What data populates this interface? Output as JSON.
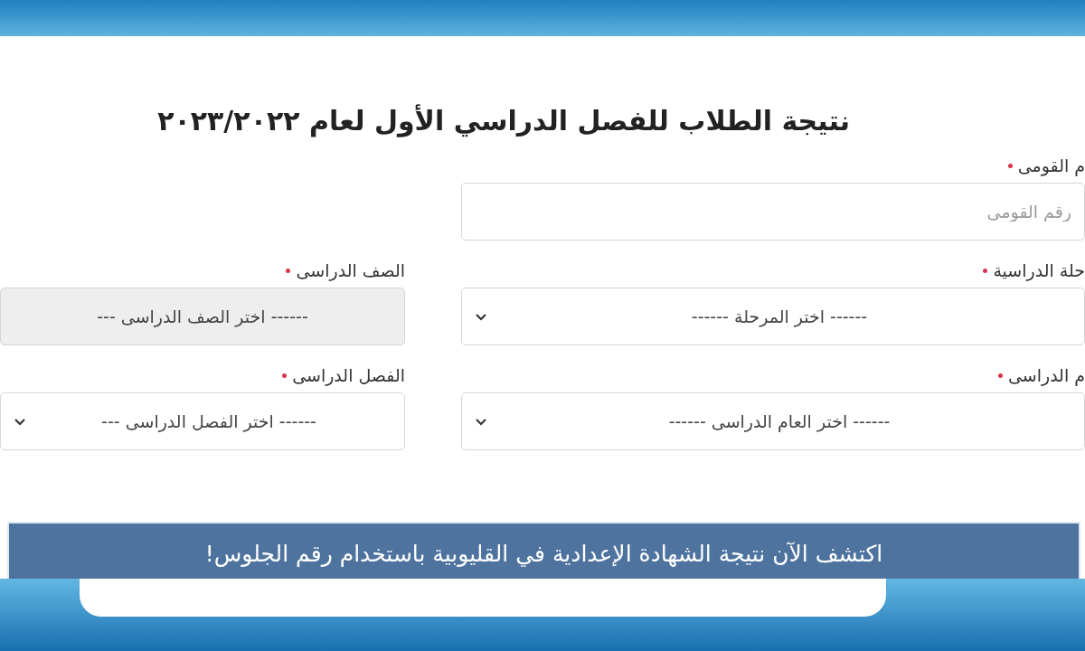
{
  "title": "نتيجة الطلاب للفصل الدراسي الأول لعام ٢٠٢٣/٢٠٢٢",
  "fields": [
    {
      "kind": "text",
      "label": "م القومى",
      "required": true,
      "placeholder": "رقم القومى",
      "disabled": false
    },
    {
      "kind": "spacer"
    },
    {
      "kind": "select",
      "label": "حلة الدراسية",
      "required": true,
      "value": "------ اختر المرحلة ------",
      "disabled": false
    },
    {
      "kind": "select",
      "label": "الصف الدراسى",
      "required": true,
      "value": "------ اختر الصف الدراسى ---",
      "disabled": true
    },
    {
      "kind": "select",
      "label": "م الدراسى",
      "required": true,
      "value": "------ اختر العام الدراسى ------",
      "disabled": false
    },
    {
      "kind": "select",
      "label": "الفصل الدراسى",
      "required": true,
      "value": "------ اختر الفصل الدراسى ---",
      "disabled": false
    }
  ],
  "banner": {
    "text": "اكتشف الآن نتيجة الشهادة الإعدادية في القليوبية باستخدام رقم الجلوس!"
  }
}
